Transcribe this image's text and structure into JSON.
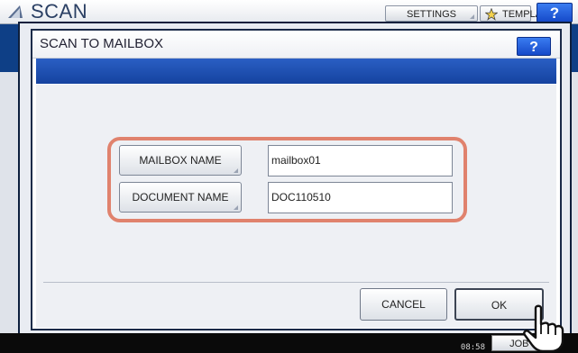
{
  "app": {
    "title": "SCAN",
    "top_buttons": {
      "settings": "SETTINGS",
      "template": "TEMPLATE",
      "help": "?"
    }
  },
  "dialog": {
    "title": "SCAN TO MAILBOX",
    "help": "?",
    "fields": [
      {
        "label": "MAILBOX NAME",
        "value": "mailbox01"
      },
      {
        "label": "DOCUMENT NAME",
        "value": "DOC110510"
      }
    ],
    "buttons": {
      "cancel": "CANCEL",
      "ok": "OK"
    }
  },
  "status": {
    "time": "08:58",
    "job_button": "JOB S"
  },
  "colors": {
    "accent_blue": "#1549c9",
    "highlight": "#e0826d"
  }
}
